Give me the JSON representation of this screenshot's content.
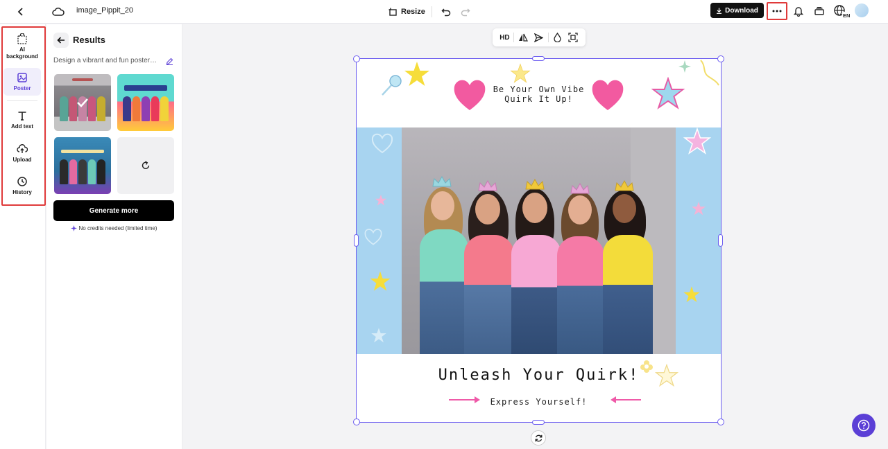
{
  "topbar": {
    "doc_title": "image_Pippit_20",
    "resize_label": "Resize",
    "download_label": "Download",
    "lang_code": "EN"
  },
  "rail": {
    "items": [
      {
        "label": "AI background",
        "icon": "ai-background-icon"
      },
      {
        "label": "Poster",
        "icon": "poster-icon",
        "active": true
      },
      {
        "label": "Add text",
        "icon": "text-icon"
      },
      {
        "label": "Upload",
        "icon": "upload-icon"
      },
      {
        "label": "History",
        "icon": "history-icon"
      }
    ]
  },
  "panel": {
    "title": "Results",
    "prompt": "Design a vibrant and fun poster ...",
    "generate_label": "Generate more",
    "credits_note": "No credits needed (limited time)"
  },
  "float_toolbar": {
    "hd_label": "HD"
  },
  "poster": {
    "headline_line1": "Be Your Own Vibe",
    "headline_line2": "Quirk It Up!",
    "title": "Unleash Your Quirk!",
    "subtitle": "Express Yourself!"
  },
  "colors": {
    "accent": "#5b3fd6",
    "selection": "#6b5cf0",
    "highlight_box": "#e03a3a",
    "pink": "#ef5aa8"
  }
}
